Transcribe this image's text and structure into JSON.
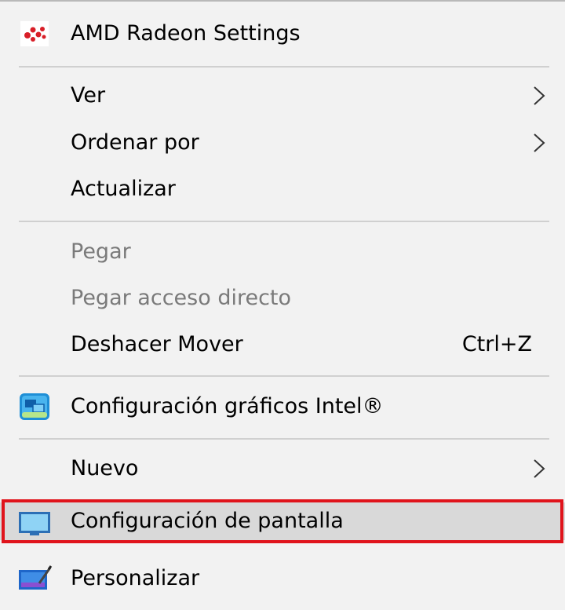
{
  "menu": {
    "items": [
      {
        "label": "AMD Radeon Settings",
        "icon": "amd-radeon-icon"
      },
      {
        "label": "Ver",
        "submenu": true
      },
      {
        "label": "Ordenar por",
        "submenu": true
      },
      {
        "label": "Actualizar"
      },
      {
        "label": "Pegar",
        "disabled": true
      },
      {
        "label": "Pegar acceso directo",
        "disabled": true
      },
      {
        "label": "Deshacer Mover",
        "shortcut": "Ctrl+Z"
      },
      {
        "label": "Configuración gráficos Intel®",
        "icon": "intel-graphics-icon"
      },
      {
        "label": "Nuevo",
        "submenu": true
      },
      {
        "label": "Configuración de pantalla",
        "icon": "display-settings-icon",
        "highlighted": true
      },
      {
        "label": "Personalizar",
        "icon": "personalize-icon"
      }
    ]
  },
  "colors": {
    "menu_background": "#f2f2f2",
    "highlight_background": "#d9d9d9",
    "focus_border": "#e0141c",
    "separator": "#d0d0d0",
    "disabled_text": "#7a7a7a"
  }
}
